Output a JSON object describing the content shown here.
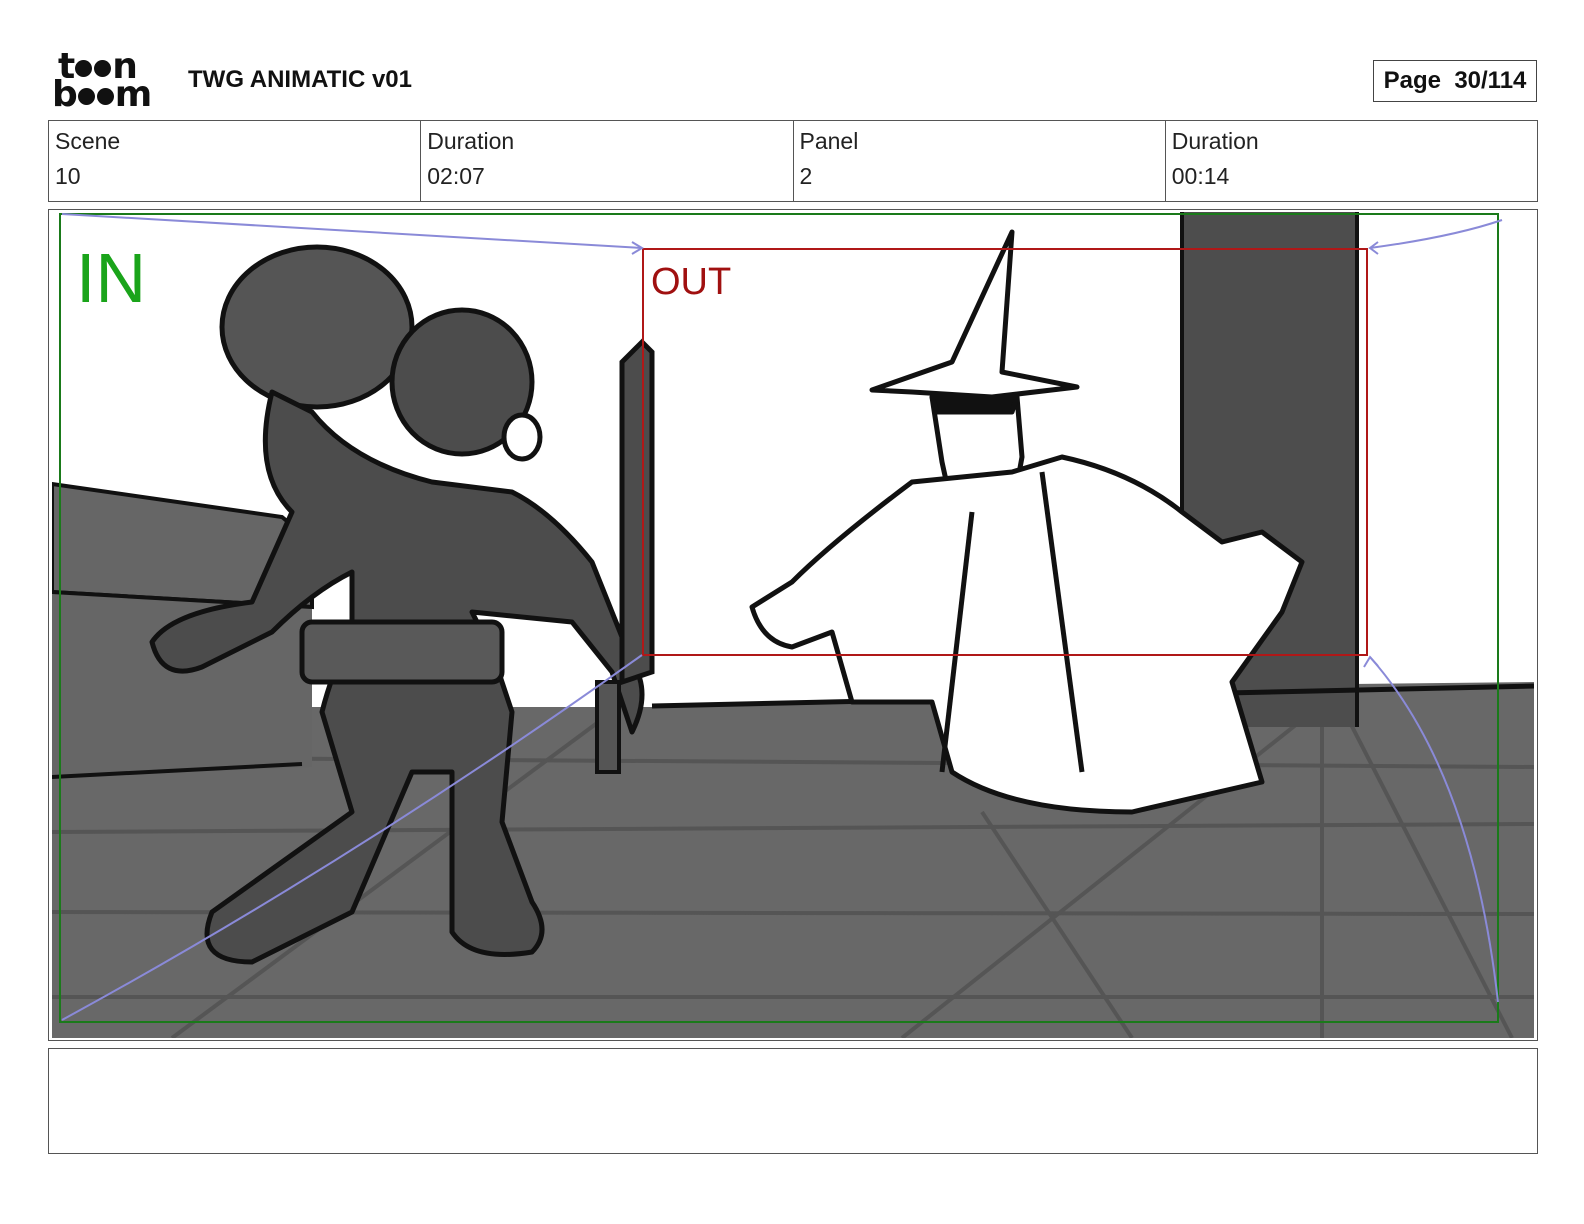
{
  "header": {
    "logo_top": "t n",
    "logo_bottom": "b m",
    "title": "TWG ANIMATIC v01",
    "page_label": "Page",
    "page_value": "30/114"
  },
  "info": {
    "scene_label": "Scene",
    "scene_value": "10",
    "duration_label": "Duration",
    "duration_value": "02:07",
    "panel_label": "Panel",
    "panel_value": "2",
    "panel_duration_label": "Duration",
    "panel_duration_value": "00:14"
  },
  "panel": {
    "in_label": "IN",
    "out_label": "OUT",
    "colors": {
      "in_frame": "#1a7a1a",
      "out_frame": "#b01818",
      "camera_path": "#8a8ad8",
      "floor": "#686868",
      "shadow_figure": "#4c4c4c"
    }
  },
  "caption": {
    "text": ""
  }
}
